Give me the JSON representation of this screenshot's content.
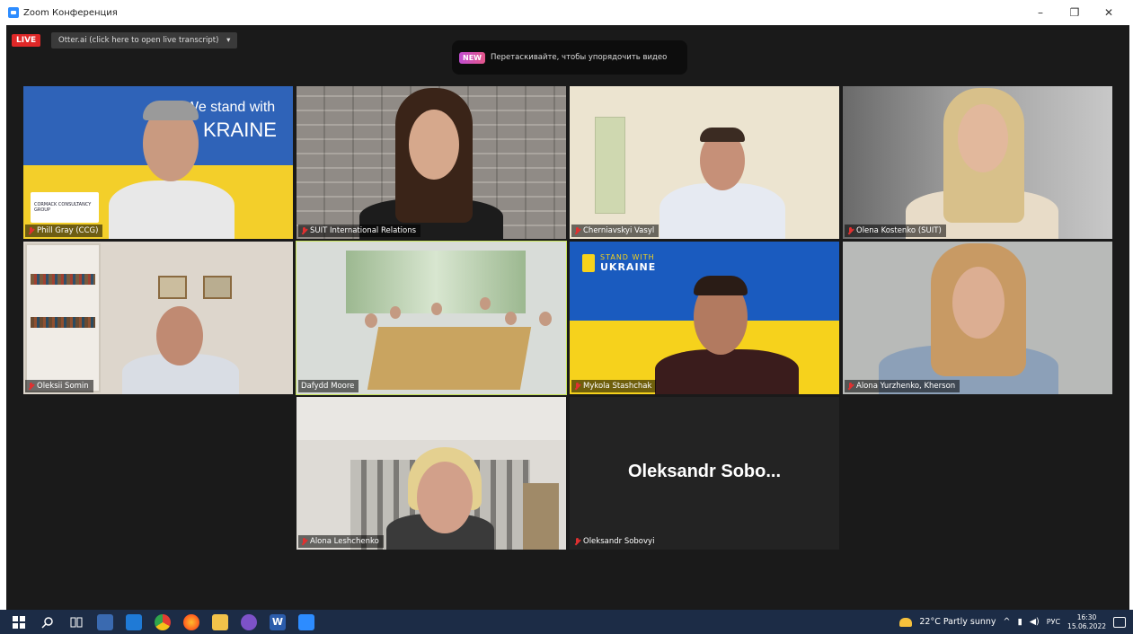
{
  "window": {
    "title": "Zoom Конференция",
    "controls": [
      "–",
      "❐",
      "✕"
    ]
  },
  "meeting": {
    "live_label": "LIVE",
    "otter_label": "Otter.ai (click here to open live transcript)",
    "otter_arrow": "▾",
    "notice_badge": "NEW",
    "notice_text": "Перетаскивайте, чтобы упорядочить видео",
    "participants": [
      {
        "name": "Phill Gray (CCG)",
        "muted": true
      },
      {
        "name": "SUIT International Relations",
        "muted": true
      },
      {
        "name": "Cherniavskyi Vasyl",
        "muted": true
      },
      {
        "name": "Olena Kostenko (SUIT)",
        "muted": true
      },
      {
        "name": "Oleksii Somin",
        "muted": true
      },
      {
        "name": "Dafydd Moore",
        "muted": false,
        "active_speaker": true
      },
      {
        "name": "Mykola Stashchak",
        "muted": true
      },
      {
        "name": "Alona Yurzhenko, Kherson",
        "muted": true
      },
      {
        "name": "Alona Leshchenko",
        "muted": true
      },
      {
        "name": "Oleksandr Sobovyi",
        "muted": true,
        "video_off": true
      }
    ],
    "tile1_banner_line1": "We stand with",
    "tile1_banner_line2": "KRAINE",
    "tile1_logo_text": "CORMACK CONSULTANCY GROUP",
    "tile7_banner_line1": "STAND WITH",
    "tile7_banner_line2": "UKRAINE",
    "video_off_name": "Oleksandr  Sobo..."
  },
  "taskbar": {
    "weather": "22°C  Partly sunny",
    "language": "РУС",
    "time": "16:30",
    "date": "15.06.2022",
    "icons": [
      "windows-start-icon",
      "search-icon",
      "task-view-icon",
      "calculator-icon",
      "mail-icon",
      "chrome-icon",
      "firefox-icon",
      "folder-icon",
      "viber-icon",
      "word-icon",
      "zoom-icon"
    ]
  },
  "colors": {
    "ukraine_blue": "#1a5bbf",
    "ukraine_yellow": "#f6d21c",
    "active_speaker": "#c6e35a",
    "live_red": "#e02828"
  }
}
